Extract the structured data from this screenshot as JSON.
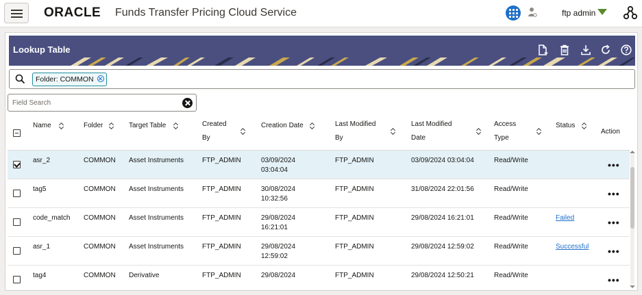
{
  "app": {
    "brand": "ORACLE",
    "title": "Funds Transfer Pricing Cloud Service",
    "user": "ftp admin"
  },
  "panel": {
    "title": "Lookup Table",
    "folder_chip": "Folder: COMMON",
    "field_search_placeholder": "Field Search"
  },
  "colors": {
    "header_bg": "#4a4f80",
    "accent_blue": "#1f6fc9",
    "selected_row": "#e4f1f7",
    "user_caret": "#5b8a2e"
  },
  "icons": {
    "toolbar": [
      "new-document-icon",
      "delete-icon",
      "download-icon",
      "refresh-icon",
      "help-icon"
    ],
    "topbar": [
      "menu-icon",
      "apps-grid-icon",
      "person-icon",
      "network-icon"
    ]
  },
  "table": {
    "columns": {
      "name": "Name",
      "folder": "Folder",
      "target_table": "Target Table",
      "created_by_1": "Created",
      "created_by_2": "By",
      "creation_date": "Creation Date",
      "last_modified_by_1": "Last Modified",
      "last_modified_by_2": "By",
      "last_modified_date_1": "Last Modified",
      "last_modified_date_2": "Date",
      "access_type_1": "Access",
      "access_type_2": "Type",
      "status": "Status",
      "action": "Action"
    },
    "rows": [
      {
        "checked": true,
        "name": "asr_2",
        "folder": "COMMON",
        "target_table": "Asset Instruments",
        "created_by": "FTP_ADMIN",
        "creation_date_1": "03/09/2024",
        "creation_date_2": "03:04:04",
        "last_modified_by": "FTP_ADMIN",
        "last_modified_date": "03/09/2024 03:04:04",
        "access_type": "Read/Write",
        "status": "",
        "action": "•••"
      },
      {
        "checked": false,
        "name": "tag5",
        "folder": "COMMON",
        "target_table": "Asset Instruments",
        "created_by": "FTP_ADMIN",
        "creation_date_1": "30/08/2024",
        "creation_date_2": "10:32:56",
        "last_modified_by": "FTP_ADMIN",
        "last_modified_date": "31/08/2024 22:01:56",
        "access_type": "Read/Write",
        "status": "",
        "action": "•••"
      },
      {
        "checked": false,
        "name": "code_match",
        "folder": "COMMON",
        "target_table": "Asset Instruments",
        "created_by": "FTP_ADMIN",
        "creation_date_1": "29/08/2024",
        "creation_date_2": "16:21:01",
        "last_modified_by": "FTP_ADMIN",
        "last_modified_date": "29/08/2024 16:21:01",
        "access_type": "Read/Write",
        "status": "Failed",
        "action": "•••"
      },
      {
        "checked": false,
        "name": "asr_1",
        "folder": "COMMON",
        "target_table": "Asset Instruments",
        "created_by": "FTP_ADMIN",
        "creation_date_1": "29/08/2024",
        "creation_date_2": "12:59:02",
        "last_modified_by": "FTP_ADMIN",
        "last_modified_date": "29/08/2024 12:59:02",
        "access_type": "Read/Write",
        "status": "Successful",
        "action": "•••"
      },
      {
        "checked": false,
        "name": "tag4",
        "folder": "COMMON",
        "target_table": "Derivative",
        "created_by": "FTP_ADMIN",
        "creation_date_1": "29/08/2024",
        "creation_date_2": "",
        "last_modified_by": "FTP_ADMIN",
        "last_modified_date": "29/08/2024 12:50:21",
        "access_type": "Read/Write",
        "status": "",
        "action": "•••"
      }
    ]
  }
}
